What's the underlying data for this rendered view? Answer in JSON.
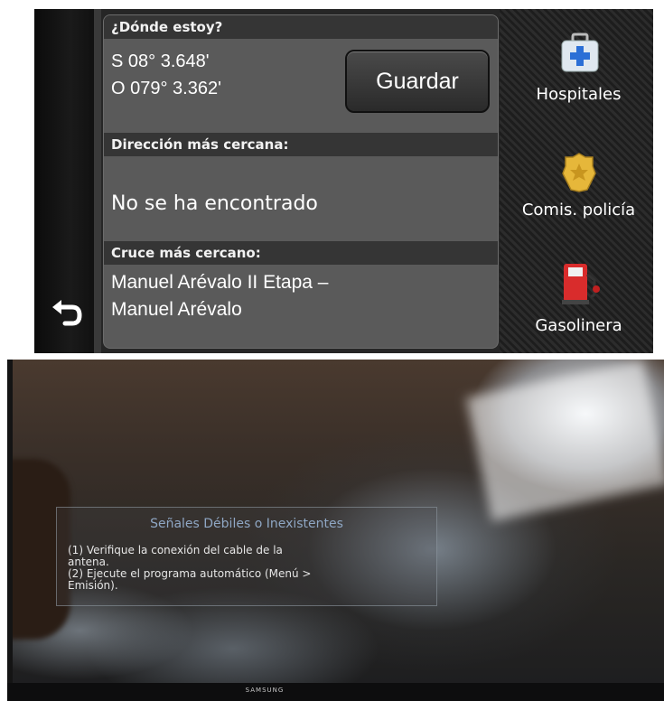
{
  "gps": {
    "section_where": "¿Dónde estoy?",
    "lat": "S  08° 3.648'",
    "lon": "O 079° 3.362'",
    "save_label": "Guardar",
    "section_address": "Dirección más cercana:",
    "address_value": "No se ha encontrado",
    "section_crossing": "Cruce más cercano:",
    "crossing_line1": "Manuel Arévalo II Etapa –",
    "crossing_line2": "Manuel Arévalo",
    "side_items": [
      {
        "label": "Hospitales",
        "icon": "first-aid-kit-icon"
      },
      {
        "label": "Comis. policía",
        "icon": "police-badge-icon"
      },
      {
        "label": "Gasolinera",
        "icon": "fuel-pump-icon"
      }
    ],
    "back_icon": "back-arrow-icon"
  },
  "tv": {
    "brand": "SAMSUNG",
    "dialog_title": "Señales Débiles o Inexistentes",
    "line1": "(1) Verifique la conexión del cable de la",
    "line2": "antena.",
    "line3": "(2) Ejecute el programa automático (Menú >",
    "line4": "Emisión)."
  }
}
